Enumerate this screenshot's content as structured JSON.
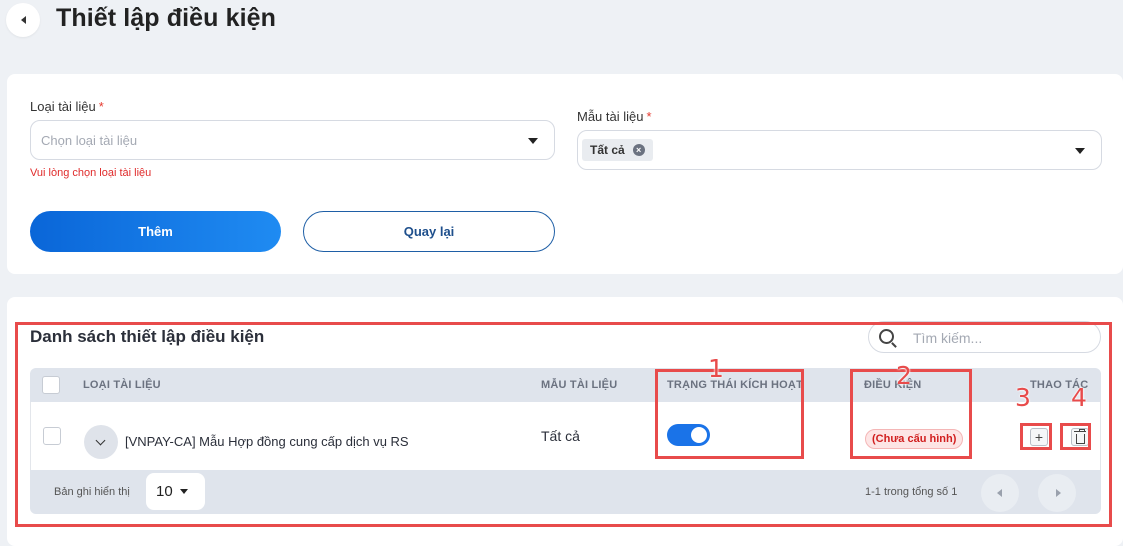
{
  "header": {
    "title": "Thiết lập điều kiện"
  },
  "form": {
    "doc_type_label": "Loại tài liệu",
    "doc_type_required": "*",
    "doc_type_placeholder": "Chọn loại tài liệu",
    "doc_type_error": "Vui lòng chọn loại tài liệu",
    "template_label": "Mẫu tài liệu",
    "template_required": "*",
    "template_chip": "Tất cả",
    "add_button": "Thêm",
    "back_button": "Quay lại"
  },
  "list": {
    "title": "Danh sách thiết lập điều kiện",
    "search_placeholder": "Tìm kiếm...",
    "columns": {
      "doc_type": "LOẠI TÀI LIỆU",
      "template": "MẪU TÀI LIỆU",
      "status": "TRẠNG THÁI KÍCH HOẠT",
      "condition": "ĐIỀU KIỆN",
      "actions": "THAO TÁC"
    },
    "rows": [
      {
        "doc_type": "[VNPAY-CA] Mẫu Hợp đồng cung cấp dịch vụ RS",
        "template": "Tất cả",
        "active": true,
        "condition": "(Chưa cấu hình)"
      }
    ],
    "footer": {
      "per_page_label": "Bản ghi hiển thị",
      "per_page_value": "10",
      "range_text": "1-1 trong tổng số 1"
    }
  },
  "annotations": {
    "n1": "1",
    "n2": "2",
    "n3": "3",
    "n4": "4",
    "color": "#e84b4b"
  },
  "colors": {
    "primary": "#1a73e8",
    "error": "#e02b2b"
  }
}
